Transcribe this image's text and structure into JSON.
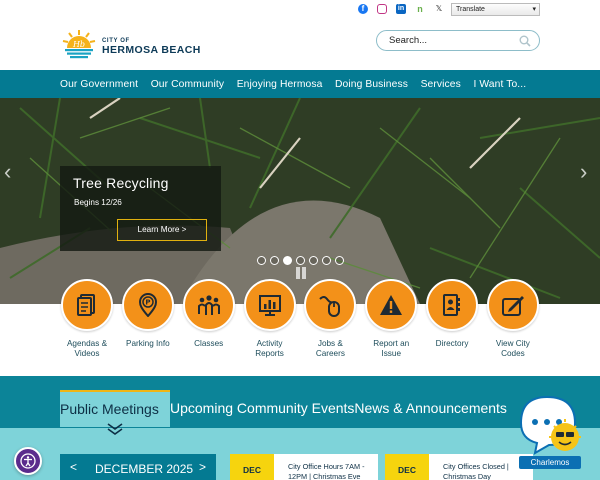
{
  "topbar": {
    "social_icons": [
      "facebook-icon",
      "instagram-icon",
      "linkedin-icon",
      "nextdoor-icon",
      "x-icon"
    ],
    "social_glyphs": {
      "facebook": "f",
      "instagram": "",
      "linkedin": "in",
      "nextdoor": "n",
      "x": "𝕏"
    },
    "translate_label": "Translate"
  },
  "logo": {
    "line1": "CITY OF",
    "line2": "HERMOSA BEACH",
    "monogram": "Hb"
  },
  "search": {
    "placeholder": "Search..."
  },
  "nav": {
    "items": [
      "Our Government",
      "Our Community",
      "Enjoying Hermosa",
      "Doing Business",
      "Services",
      "I Want To..."
    ]
  },
  "hero": {
    "title": "Tree Recycling",
    "subtitle": "Begins 12/26",
    "button_label": "Learn More >",
    "slide_count": 7,
    "active_slide": 3
  },
  "quick_links": [
    {
      "label": "Agendas & Videos",
      "icon": "document-icon"
    },
    {
      "label": "Parking Info",
      "icon": "parking-pin-icon"
    },
    {
      "label": "Classes",
      "icon": "people-group-icon"
    },
    {
      "label": "Activity Reports",
      "icon": "bar-chart-icon"
    },
    {
      "label": "Jobs & Careers",
      "icon": "mouse-icon"
    },
    {
      "label": "Report an Issue",
      "icon": "warning-icon"
    },
    {
      "label": "Directory",
      "icon": "directory-icon"
    },
    {
      "label": "View City Codes",
      "icon": "book-icon"
    }
  ],
  "tabs": [
    "Public Meetings",
    "Upcoming Community Events",
    "News & Announcements"
  ],
  "active_tab": 0,
  "calendar": {
    "month": "DECEMBER 2025",
    "prev": "<",
    "next": ">"
  },
  "events": [
    {
      "date": "DEC",
      "text": "City Office Hours 7AM - 12PM | Christmas Eve"
    },
    {
      "date": "DEC",
      "text": "City Offices Closed | Christmas Day"
    }
  ],
  "chatbot": {
    "label": "Charlemos"
  },
  "colors": {
    "nav": "#047a92",
    "accent": "#f39119",
    "yellow": "#f6d40e",
    "teal_light": "#7ed3d9"
  }
}
